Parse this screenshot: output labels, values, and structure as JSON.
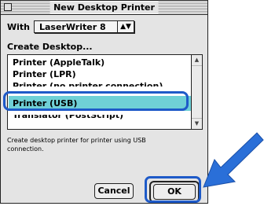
{
  "dialog": {
    "title": "New Desktop Printer",
    "with_label": "With",
    "with_value": "LaserWriter 8",
    "create_label": "Create Desktop...",
    "items": [
      {
        "label": "Printer (AppleTalk)"
      },
      {
        "label": "Printer (LPR)"
      },
      {
        "label": "Printer (no printer connection)"
      },
      {
        "label": "Printer (USB)"
      },
      {
        "label": "Translator (PostScript)"
      }
    ],
    "selected_item": "Printer (USB)",
    "description": "Create desktop printer for printer using USB connection.",
    "cancel_label": "Cancel",
    "ok_label": "OK"
  },
  "colors": {
    "selection": "#6fd0d6",
    "callout": "#1e5ac8",
    "arrow": "#2a6fd8"
  }
}
